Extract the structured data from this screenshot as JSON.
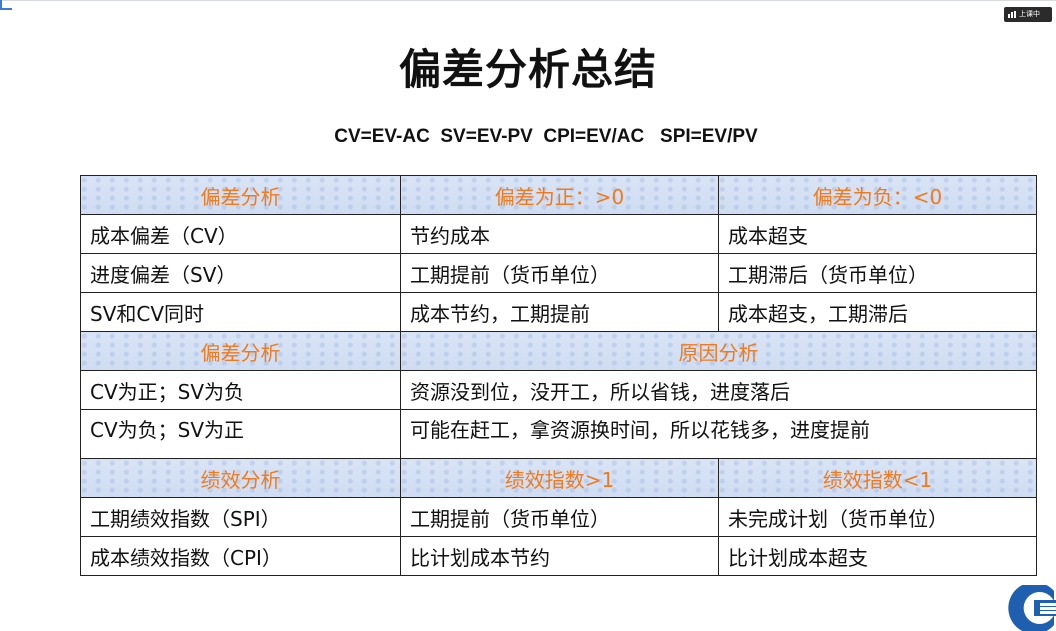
{
  "title": "偏差分析总结",
  "formulas": "CV=EV-AC  SV=EV-PV  CPI=EV/AC   SPI=EV/PV",
  "overlay": {
    "badge": "上课中"
  },
  "table": {
    "section1": {
      "header": [
        "偏差分析",
        "偏差为正：>0",
        "偏差为负：<0"
      ],
      "rows": [
        [
          "成本偏差（CV）",
          "节约成本",
          "成本超支"
        ],
        [
          "进度偏差（SV）",
          "工期提前（货币单位）",
          "工期滞后（货币单位）"
        ],
        [
          "SV和CV同时",
          "成本节约，工期提前",
          "成本超支，工期滞后"
        ]
      ]
    },
    "section2": {
      "header": [
        "偏差分析",
        "原因分析"
      ],
      "rows": [
        [
          "CV为正；SV为负",
          "资源没到位，没开工，所以省钱，进度落后"
        ],
        [
          "CV为负；SV为正",
          "可能在赶工，拿资源换时间，所以花钱多，进度提前"
        ]
      ]
    },
    "section3": {
      "header": [
        "绩效分析",
        "绩效指数>1",
        "绩效指数<1"
      ],
      "rows": [
        [
          "工期绩效指数（SPI）",
          "工期提前（货币单位）",
          "未完成计划（货币单位）"
        ],
        [
          "成本绩效指数（CPI）",
          "比计划成本节约",
          "比计划成本超支"
        ]
      ]
    }
  },
  "colors": {
    "header_text": "#f07a1c",
    "header_bg": "#d6e1f3",
    "logo_blue": "#1f5fb0"
  }
}
